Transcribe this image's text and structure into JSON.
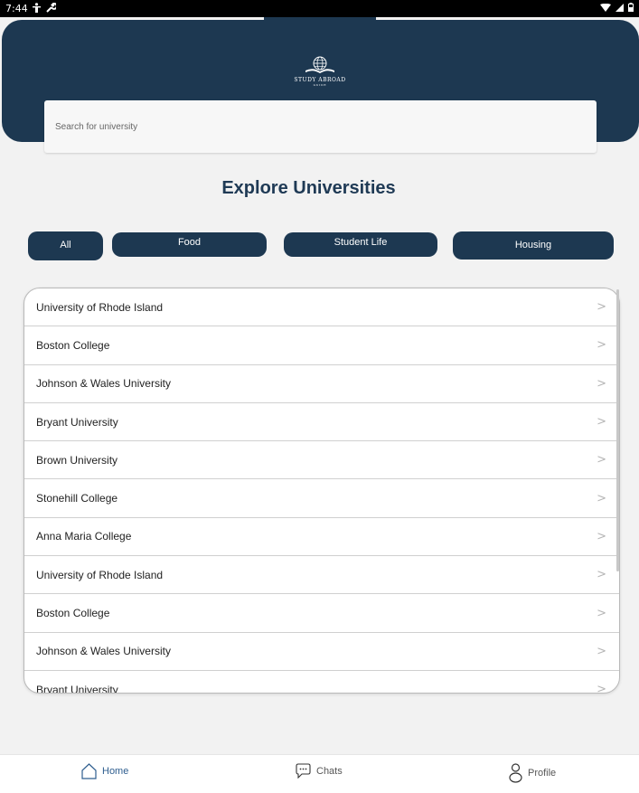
{
  "status_bar": {
    "time": "7:44"
  },
  "header": {
    "logo_text": "STUDY ABROAD",
    "logo_subtext": "GUIDE"
  },
  "search": {
    "placeholder": "Search for university"
  },
  "page_title": "Explore Universities",
  "filters": [
    "All",
    "Food",
    "Student Life",
    "Housing"
  ],
  "universities": [
    "University of Rhode Island",
    "Boston College",
    "Johnson & Wales University",
    "Bryant University",
    "Brown University",
    "Stonehill College",
    "Anna Maria College",
    "University of Rhode Island",
    "Boston College",
    "Johnson & Wales University",
    "Bryant University"
  ],
  "nav": {
    "home": "Home",
    "chats": "Chats",
    "profile": "Profile"
  },
  "colors": {
    "primary": "#1d3851",
    "background": "#f2f2f2",
    "active_nav": "#2f5e8f"
  }
}
